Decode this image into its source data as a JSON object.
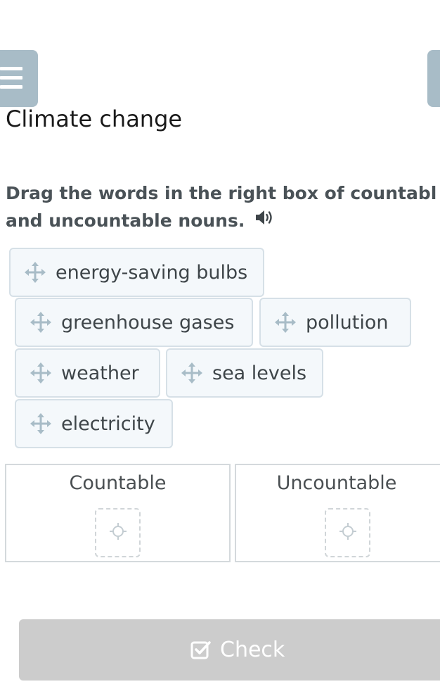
{
  "page": {
    "title": "Climate change",
    "instruction_line1": "Drag the words in the right box of countabl",
    "instruction_line2": "and uncountable nouns."
  },
  "words": [
    {
      "label": "energy-saving bulbs"
    },
    {
      "label": "greenhouse gases"
    },
    {
      "label": "pollution"
    },
    {
      "label": "weather"
    },
    {
      "label": "sea levels"
    },
    {
      "label": "electricity"
    }
  ],
  "dropzones": [
    {
      "label": "Countable"
    },
    {
      "label": "Uncountable"
    }
  ],
  "actions": {
    "check_label": "Check"
  },
  "colors": {
    "accent_gray_blue": "#a8bcc7",
    "word_bg": "#f4f8fb",
    "word_border": "#d6e0e7",
    "button_disabled": "#cccccc"
  },
  "icons": {
    "menu": "hamburger-icon",
    "audio": "speaker-icon",
    "drag": "move-arrows-icon",
    "drop": "target-crosshair-icon",
    "check": "checkbox-check-icon"
  }
}
